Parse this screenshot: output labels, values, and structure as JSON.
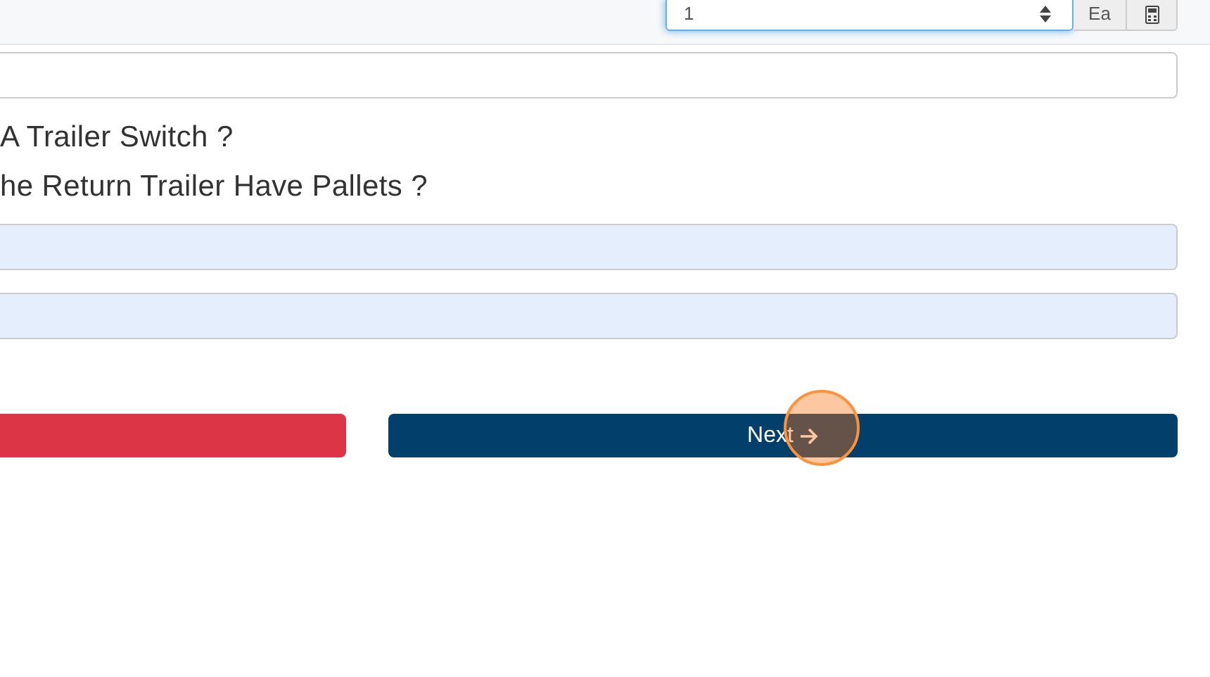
{
  "quantity": {
    "value": "1",
    "focused": true,
    "unit": "Ea"
  },
  "questions": [
    "A Trailer Switch ?",
    "he Return Trailer Have Pallets ?"
  ],
  "answer_fields": [
    {
      "autofilled": true
    },
    {
      "autofilled": true
    }
  ],
  "buttons": [
    {
      "kind": "danger"
    },
    {
      "kind": "primary",
      "label": "Next"
    }
  ],
  "click_indicator": true
}
